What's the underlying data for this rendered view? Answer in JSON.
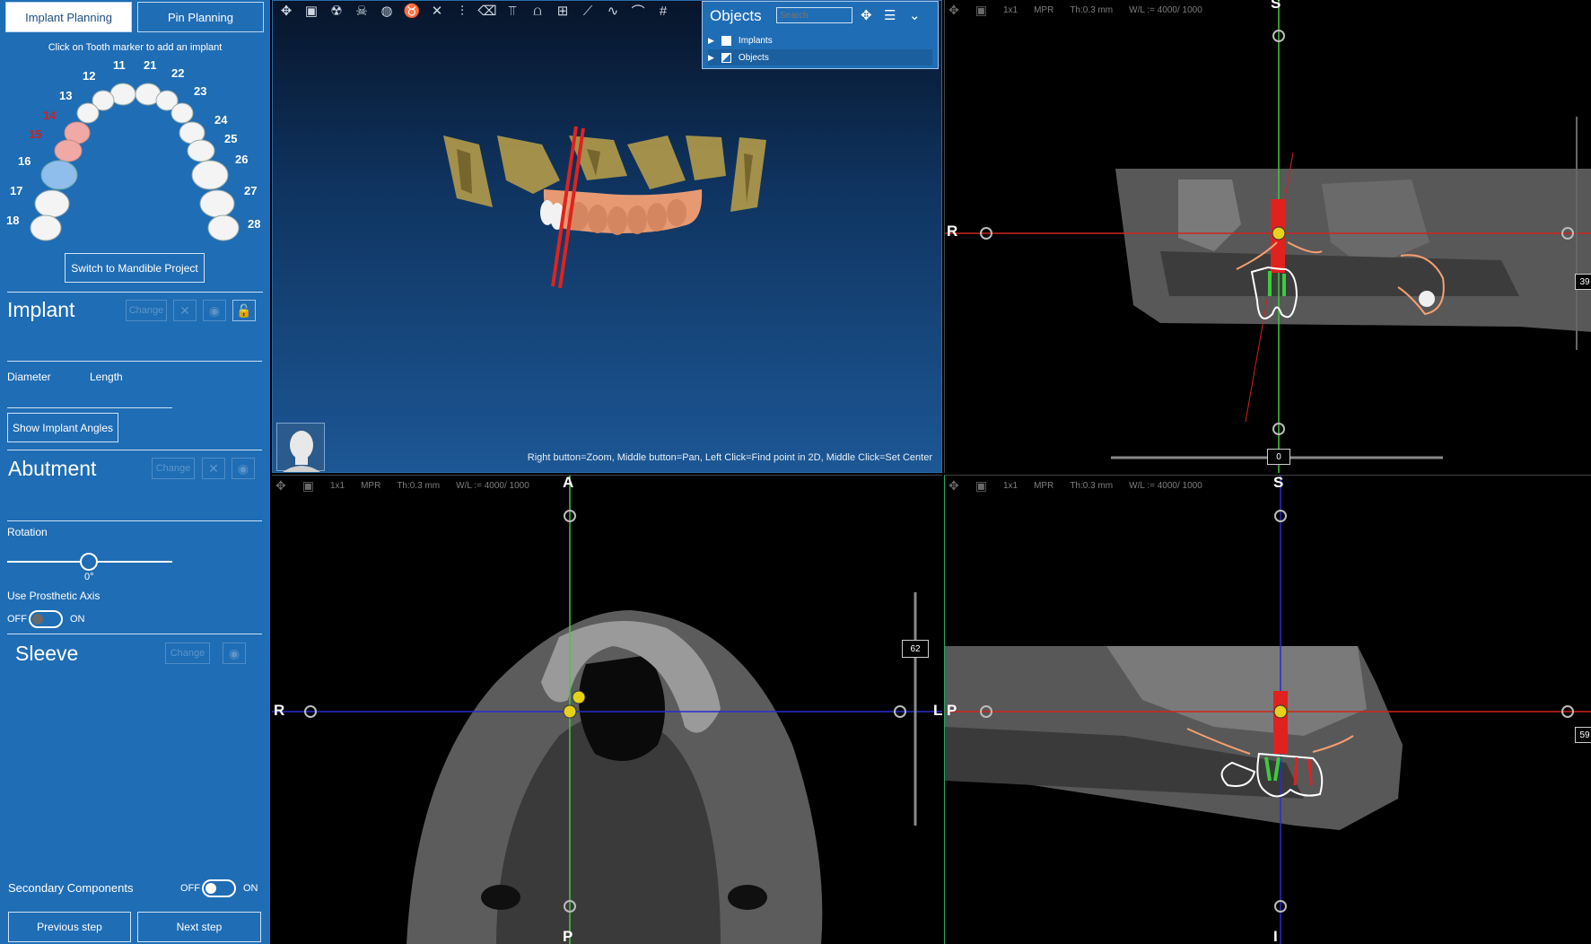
{
  "tabs": {
    "implant_planning": "Implant Planning",
    "pin_planning": "Pin Planning"
  },
  "hint": "Click on Tooth marker to add an implant",
  "teeth": [
    "11",
    "12",
    "13",
    "14",
    "15",
    "16",
    "17",
    "18",
    "21",
    "22",
    "23",
    "24",
    "25",
    "26",
    "27",
    "28"
  ],
  "switch_mandible": "Switch to Mandible Project",
  "implant": {
    "title": "Implant",
    "change": "Change",
    "diameter": "Diameter",
    "length": "Length",
    "show_angles": "Show Implant Angles"
  },
  "abutment": {
    "title": "Abutment",
    "change": "Change",
    "rotation": "Rotation",
    "rotation_value": "0°",
    "use_prosthetic_axis": "Use Prosthetic Axis",
    "off": "OFF",
    "on": "ON"
  },
  "sleeve": {
    "title": "Sleeve",
    "change": "Change"
  },
  "secondary": {
    "label": "Secondary Components",
    "off": "OFF",
    "on": "ON"
  },
  "nav": {
    "previous": "Previous step",
    "next": "Next step"
  },
  "objects_panel": {
    "title": "Objects",
    "search_placeholder": "Search",
    "rows": [
      "Implants",
      "Objects"
    ]
  },
  "viewer3d": {
    "help": "Right button=Zoom, Middle button=Pan, Left Click=Find point in 2D, Middle Click=Set Center"
  },
  "mpr": {
    "layout": "1x1",
    "mode": "MPR",
    "thickness": "Th:0.3 mm",
    "window_level": "W/L := 4000/ 1000"
  },
  "coronal": {
    "top": "S",
    "left": "R",
    "slider_value": "0",
    "right_box": "39"
  },
  "axial": {
    "top": "A",
    "bottom": "P",
    "left": "R",
    "right": "L",
    "side_box": "62"
  },
  "sagittal": {
    "top": "S",
    "bottom": "I",
    "left": "P",
    "right_box": "59"
  },
  "colors": {
    "panel_blue": "#1f6db5",
    "implant_red": "#e0221e",
    "crosshair_green": "#3ccb3c",
    "crosshair_blue": "#2b2bd0",
    "crosshair_red": "#d0241c",
    "marker_yellow": "#e6d21a"
  }
}
